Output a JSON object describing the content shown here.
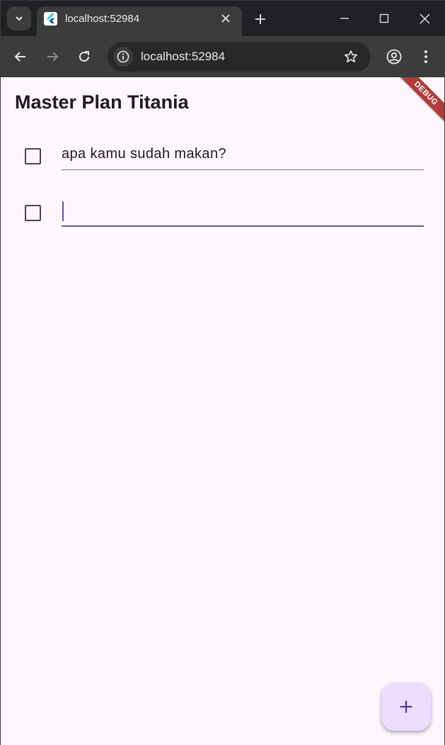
{
  "browser": {
    "tab_title": "localhost:52984",
    "url": "localhost:52984"
  },
  "app": {
    "title": "Master Plan Titania",
    "debug_banner": "DEBUG",
    "tasks": [
      {
        "description": "apa kamu sudah makan?",
        "complete": false
      },
      {
        "description": "",
        "complete": false
      }
    ],
    "fab_icon": "add-icon"
  },
  "colors": {
    "primary": "#6750a4",
    "background": "#fdf7fd",
    "fab_background": "#eaddff"
  }
}
